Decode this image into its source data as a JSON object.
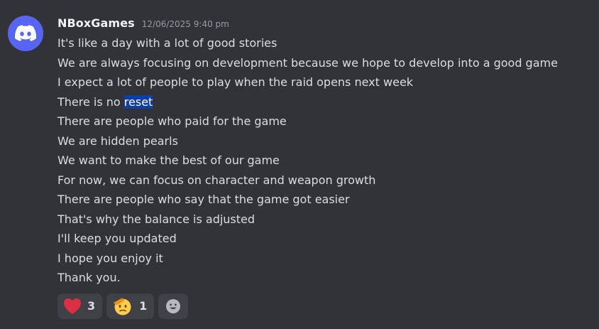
{
  "message": {
    "username": "NBoxGames",
    "timestamp": "12/06/2025 9:40 pm",
    "lines": [
      "It's like a day with a lot of good stories",
      "We are always focusing on development because we hope to develop into a good game",
      "I expect a lot of people to play when the raid opens next week",
      "There is no ",
      "There are people who paid for the game",
      "We are hidden pearls",
      "We want to make the best of our game",
      "For now, we can focus on character and weapon growth",
      "There are people who say that the game got easier",
      "That's why the balance is adjusted",
      "I'll keep you updated",
      "I hope you enjoy it",
      "Thank you."
    ],
    "highlighted_word": "reset"
  },
  "reactions": [
    {
      "icon": "heart-emoji-icon",
      "count": "3",
      "color": "#dd2e44"
    },
    {
      "icon": "saluting-face-emoji-icon",
      "count": "1",
      "color": "#ffcc4d"
    }
  ],
  "add_reaction": {
    "icon": "smiley-add-reaction-icon"
  },
  "colors": {
    "background": "#323339",
    "accent": "#5865f2",
    "text_selection": "#0b3ea6"
  }
}
